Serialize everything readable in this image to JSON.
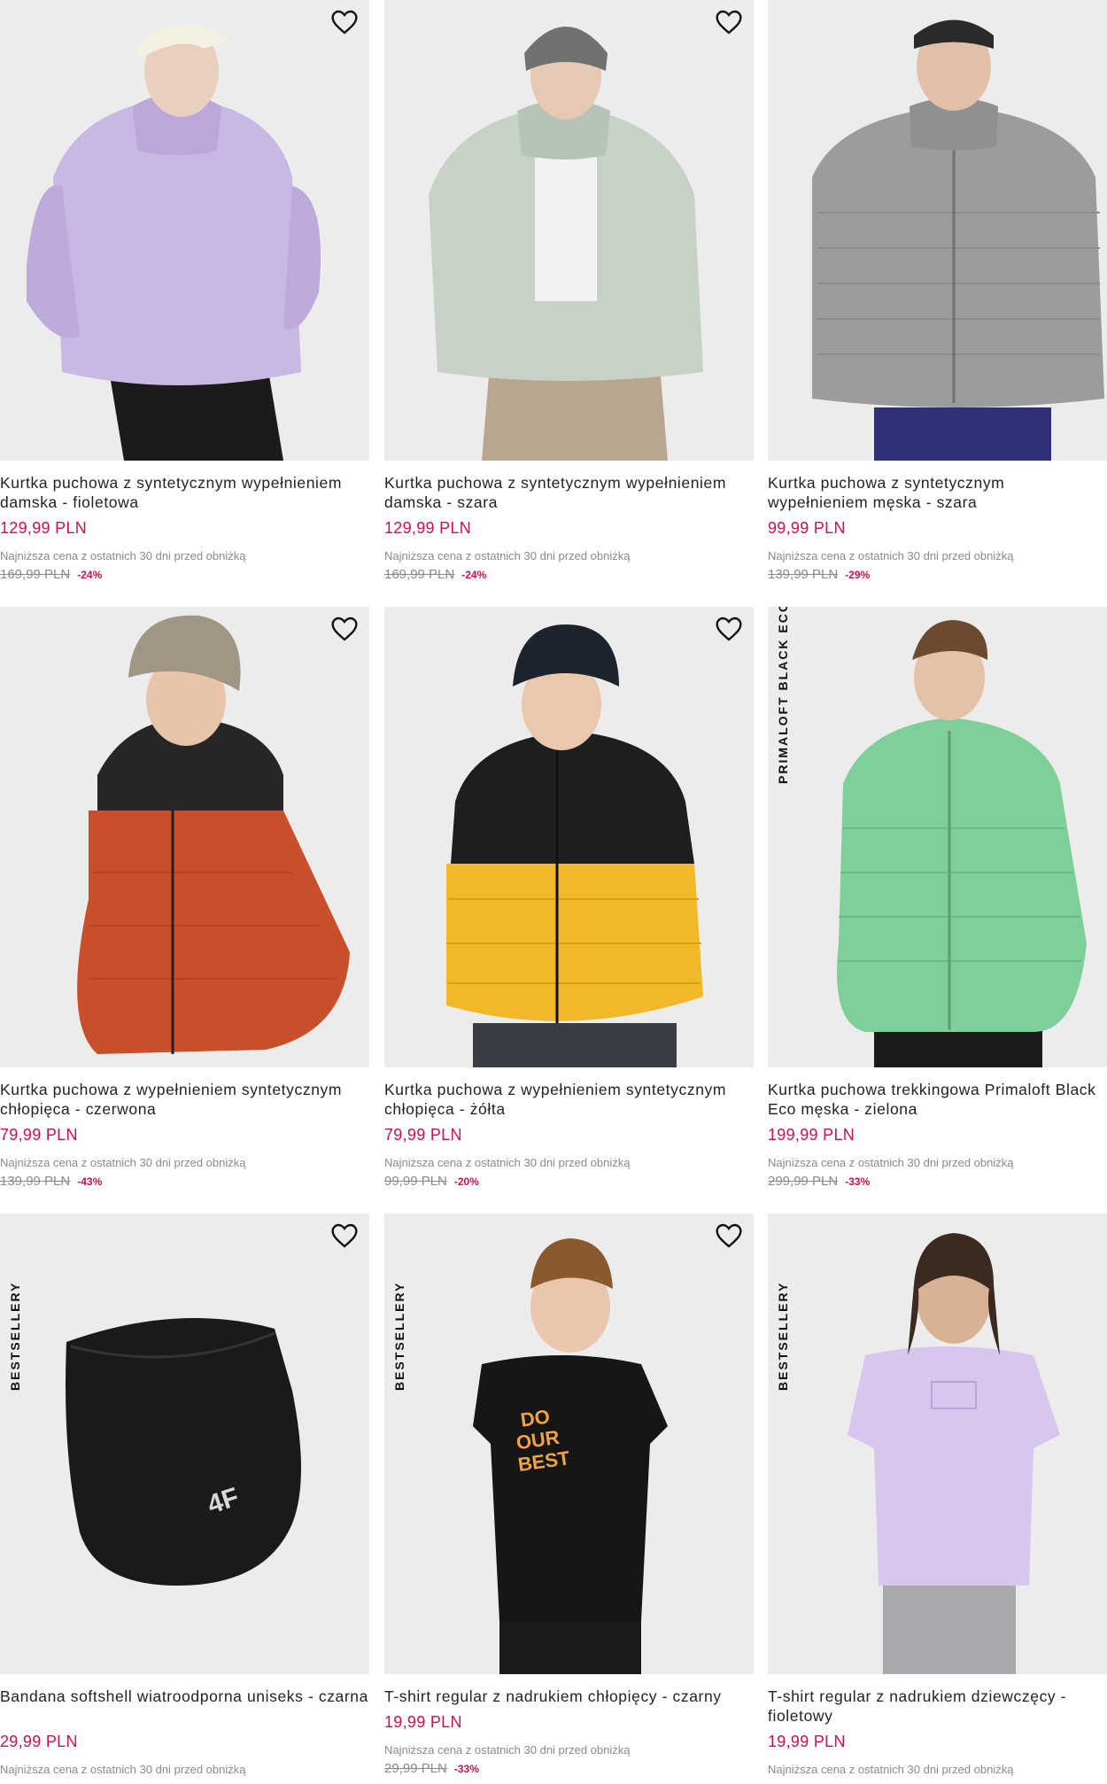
{
  "labels": {
    "lowest_note": "Najniższa cena z ostatnich 30 dni przed obniżką"
  },
  "colors": {
    "price": "#c8124f",
    "muted": "#8a8a8a",
    "photo_bg": "#ececec"
  },
  "products": [
    {
      "title": "Kurtka puchowa z syntetycznym wypełnieniem damska - fioletowa",
      "price": "129,99 PLN",
      "old_price": "169,99 PLN",
      "discount": "-24%",
      "badge": "",
      "icon": "heart-icon",
      "garment_color": "#c9b8e3"
    },
    {
      "title": "Kurtka puchowa z syntetycznym wypełnieniem damska - szara",
      "price": "129,99 PLN",
      "old_price": "169,99 PLN",
      "discount": "-24%",
      "badge": "",
      "icon": "heart-icon",
      "garment_color": "#c6d2c6"
    },
    {
      "title": "Kurtka puchowa z syntetycznym wypełnieniem męska - szara",
      "price": "99,99 PLN",
      "old_price": "139,99 PLN",
      "discount": "-29%",
      "badge": "",
      "icon": "heart-icon",
      "garment_color": "#9a9c9e"
    },
    {
      "title": "Kurtka puchowa z wypełnieniem syntetycznym chłopięca - czerwona",
      "price": "79,99 PLN",
      "old_price": "139,99 PLN",
      "discount": "-43%",
      "badge": "",
      "icon": "heart-icon",
      "garment_color": "#c94e2a"
    },
    {
      "title": "Kurtka puchowa z wypełnieniem syntetycznym chłopięca - żółta",
      "price": "79,99 PLN",
      "old_price": "99,99 PLN",
      "discount": "-20%",
      "badge": "",
      "icon": "heart-icon",
      "garment_color": "#f1b82a"
    },
    {
      "title": "Kurtka puchowa trekkingowa Primaloft Black Eco męska - zielona",
      "price": "199,99 PLN",
      "old_price": "299,99 PLN",
      "discount": "-33%",
      "badge": "PRIMALOFT BLACK ECO",
      "icon": "heart-icon",
      "garment_color": "#7fcf9a"
    },
    {
      "title": "Bandana softshell wiatroodporna uniseks - czarna",
      "price": "29,99 PLN",
      "old_price": "",
      "discount": "",
      "badge": "BESTSELLERY",
      "icon": "heart-icon",
      "garment_color": "#1a1a1a",
      "logo": "4F"
    },
    {
      "title": "T-shirt regular z nadrukiem chłopięcy - czarny",
      "price": "19,99 PLN",
      "old_price": "29,99 PLN",
      "discount": "-33%",
      "badge": "BESTSELLERY",
      "icon": "heart-icon",
      "garment_color": "#161616",
      "print_text": "DO OUR BEST"
    },
    {
      "title": "T-shirt regular z nadrukiem dziewczęcy - fioletowy",
      "price": "19,99 PLN",
      "old_price": "",
      "discount": "",
      "badge": "BESTSELLERY",
      "icon": "heart-icon",
      "garment_color": "#d8c6ef"
    }
  ]
}
